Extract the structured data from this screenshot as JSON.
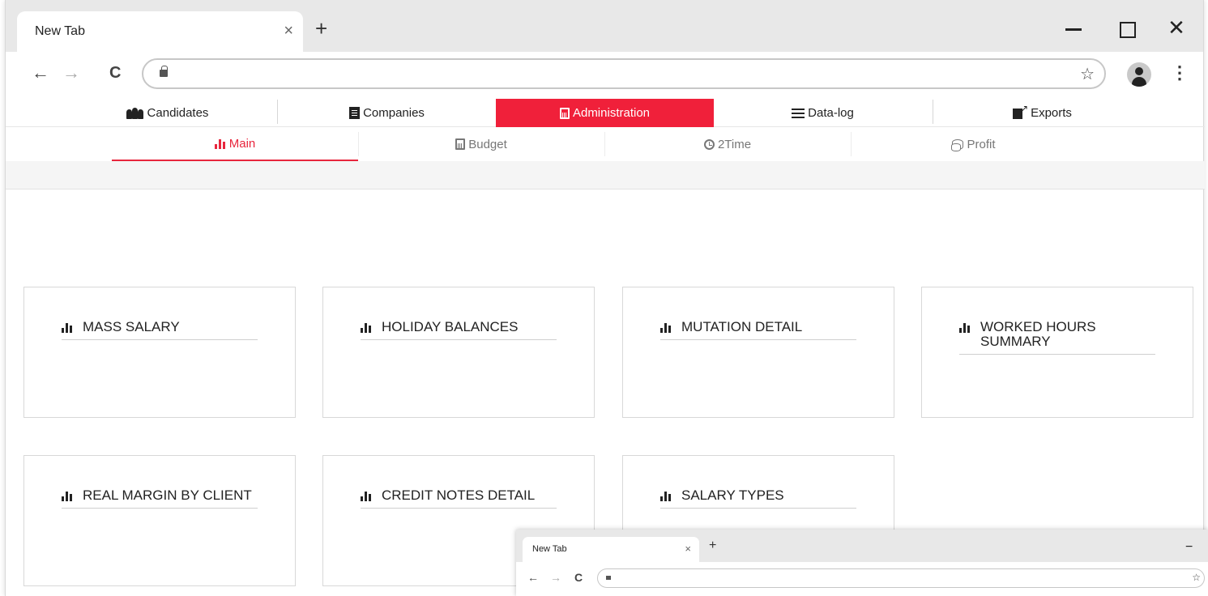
{
  "browser": {
    "tab_title": "New Tab",
    "tab_close": "×",
    "new_tab": "+",
    "close_window": "✕",
    "back": "←",
    "forward": "→",
    "reload": "C",
    "star": "☆",
    "menu": "⋮",
    "address": ""
  },
  "main_nav": [
    {
      "label": "Candidates",
      "icon": "users-icon"
    },
    {
      "label": "Companies",
      "icon": "building-icon"
    },
    {
      "label": "Administration",
      "icon": "calculator-icon",
      "active": true
    },
    {
      "label": "Data-log",
      "icon": "list-icon"
    },
    {
      "label": "Exports",
      "icon": "export-icon"
    }
  ],
  "sub_nav": [
    {
      "label": "Main",
      "icon": "bar-chart-icon",
      "active": true
    },
    {
      "label": "Budget",
      "icon": "calculator-icon"
    },
    {
      "label": "2Time",
      "icon": "clock-icon"
    },
    {
      "label": "Profit",
      "icon": "coins-icon"
    }
  ],
  "reports": [
    {
      "title": "MASS SALARY"
    },
    {
      "title": "HOLIDAY BALANCES"
    },
    {
      "title": "MUTATION DETAIL"
    },
    {
      "title": "WORKED HOURS SUMMARY"
    },
    {
      "title": "REAL MARGIN BY CLIENT"
    },
    {
      "title": "CREDIT NOTES DETAIL"
    },
    {
      "title": "SALARY TYPES"
    }
  ],
  "mini_browser": {
    "tab_title": "New Tab",
    "tab_close": "×",
    "new_tab": "+",
    "minimize": "−",
    "back": "←",
    "forward": "→",
    "reload": "C",
    "star": "☆"
  },
  "colors": {
    "accent": "#f0203a",
    "active_subnav": "#e8263d"
  }
}
